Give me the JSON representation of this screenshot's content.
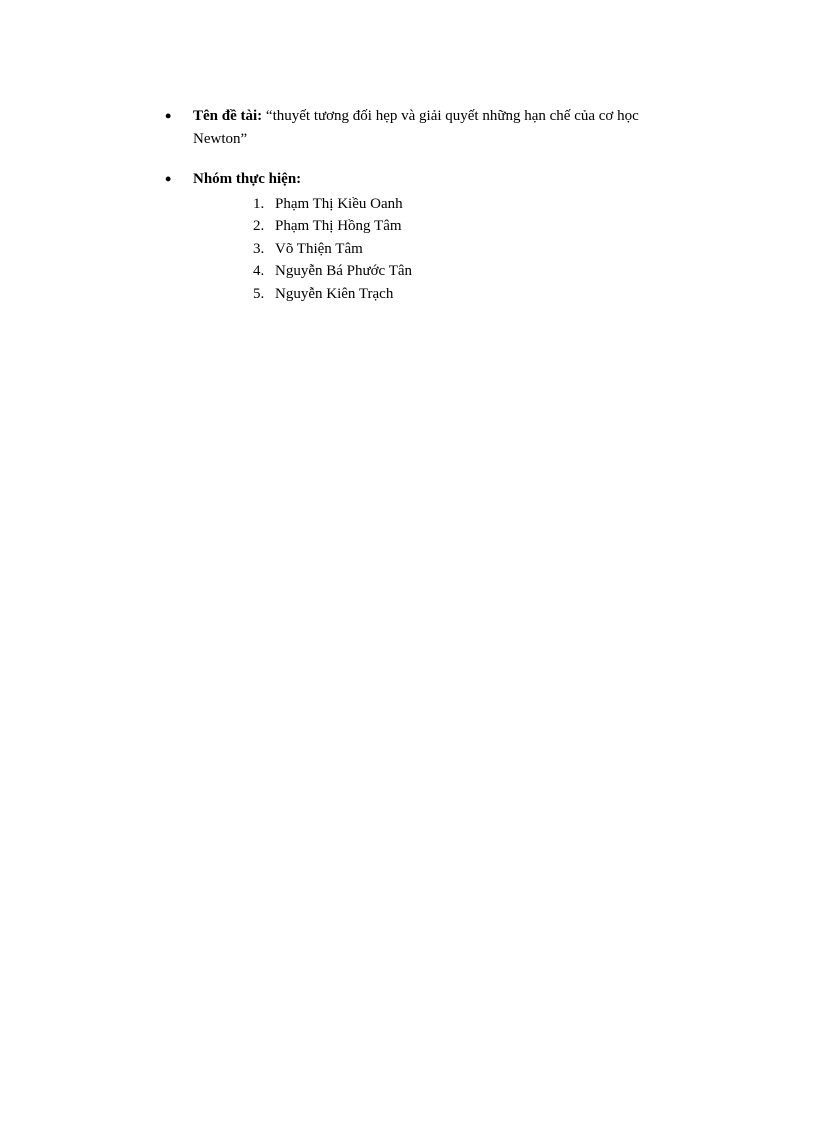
{
  "topic": {
    "label": "Tên đề tài:",
    "value": "“thuyết tương đối hẹp và giải quyết những hạn chế của cơ học Newton”"
  },
  "team": {
    "label": "Nhóm thực hiện:",
    "members": [
      {
        "num": "1.",
        "name": "Phạm Thị Kiều Oanh"
      },
      {
        "num": "2.",
        "name": "Phạm Thị Hồng Tâm"
      },
      {
        "num": "3.",
        "name": "Võ Thiện Tâm"
      },
      {
        "num": "4.",
        "name": "Nguyễn Bá Phước Tân"
      },
      {
        "num": "5.",
        "name": "Nguyễn Kiên Trạch"
      }
    ]
  }
}
